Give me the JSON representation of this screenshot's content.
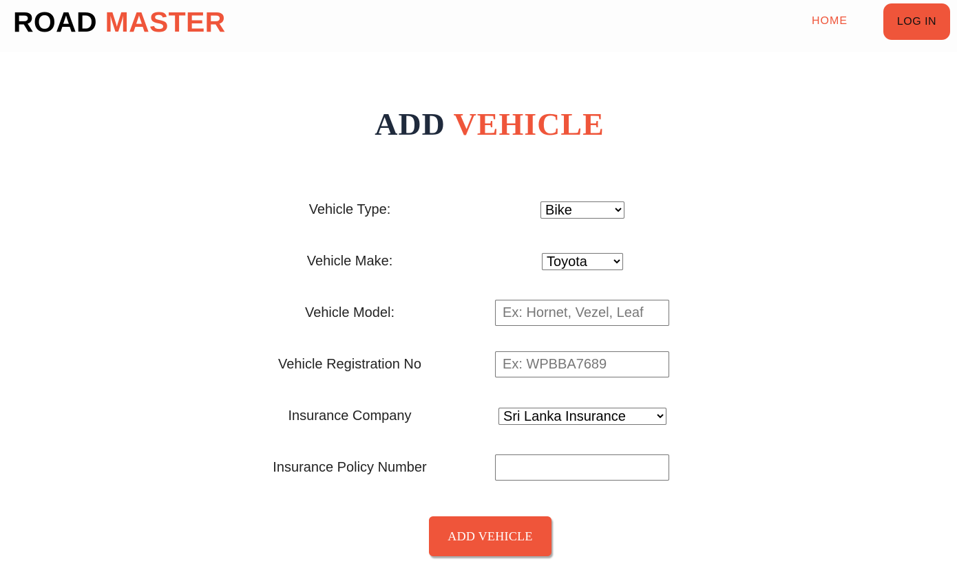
{
  "header": {
    "brand_part1": "ROAD",
    "brand_part2": "MASTER",
    "nav_home": "HOME",
    "login_label": "LOG IN"
  },
  "title": {
    "part1": "ADD",
    "part2": "VEHICLE"
  },
  "form": {
    "vehicle_type": {
      "label": "Vehicle Type:",
      "value": "Bike"
    },
    "vehicle_make": {
      "label": "Vehicle Make:",
      "value": "Toyota"
    },
    "vehicle_model": {
      "label": "Vehicle Model:",
      "placeholder": "Ex: Hornet, Vezel, Leaf",
      "value": ""
    },
    "registration_no": {
      "label": "Vehicle Registration No",
      "placeholder": "Ex: WPBBA7689",
      "value": ""
    },
    "insurance_company": {
      "label": "Insurance Company",
      "value": "Sri Lanka Insurance"
    },
    "policy_number": {
      "label": "Insurance Policy Number",
      "placeholder": "",
      "value": ""
    },
    "submit_label": "ADD VEHICLE"
  },
  "colors": {
    "accent": "#ef553a",
    "title_dark": "#1f2a3c"
  }
}
